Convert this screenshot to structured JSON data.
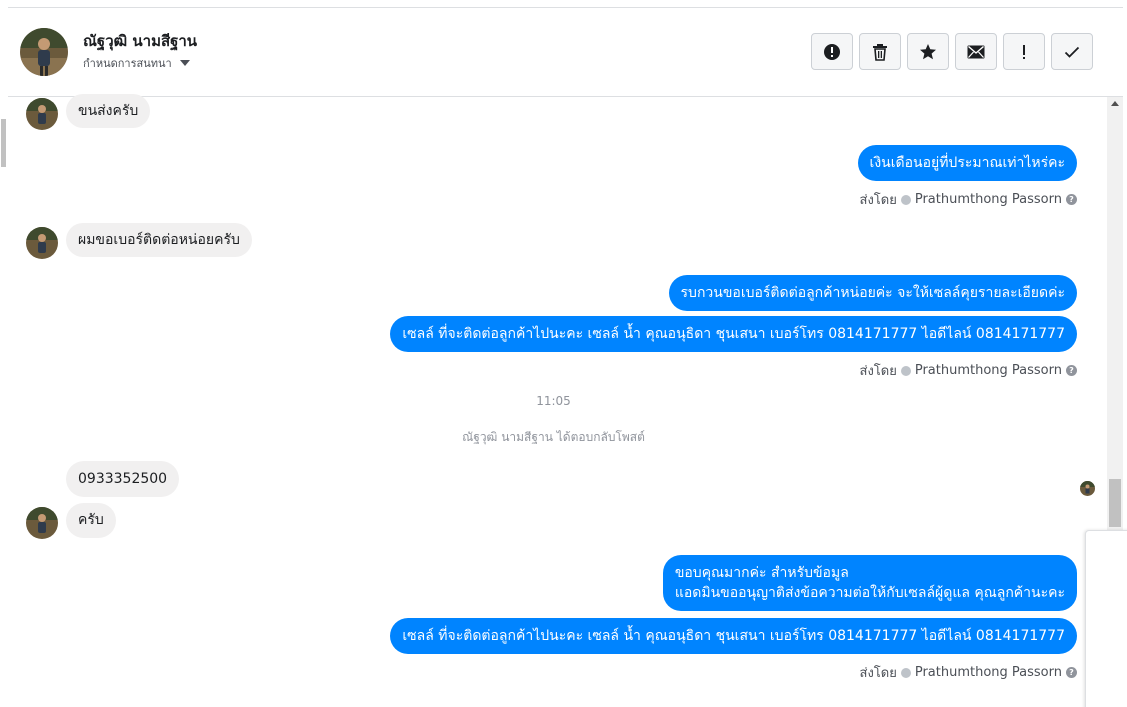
{
  "header": {
    "contact_name": "ณัฐวุฒิ นามสีฐาน",
    "subtitle": "กำหนดการสนทนา",
    "actions": [
      {
        "icon": "alert-circle-icon",
        "label": "mark-spam"
      },
      {
        "icon": "trash-icon",
        "label": "delete"
      },
      {
        "icon": "star-icon",
        "label": "star"
      },
      {
        "icon": "envelope-icon",
        "label": "mark-unread"
      },
      {
        "icon": "exclamation-icon",
        "label": "follow-up"
      },
      {
        "icon": "checkmark-icon",
        "label": "done"
      }
    ]
  },
  "conversation": {
    "messages": [
      {
        "from": "contact",
        "text": "ขนส่งครับ"
      },
      {
        "from": "page",
        "text": "เงินเดือนอยู่ที่ประมาณเท่าไหร่คะ"
      },
      {
        "from": "contact",
        "text": "ผมขอเบอร์ติดต่อหน่อยครับ"
      },
      {
        "from": "page",
        "text": "รบกวนขอเบอร์ติดต่อลูกค้าหน่อยค่ะ จะให้เซลล์คุยรายละเอียดค่ะ"
      },
      {
        "from": "page",
        "text": "เซลล์ ที่จะติดต่อลูกค้าไปนะคะ เซลล์ น้ำ คุณอนุธิดา ชุนเสนา เบอร์โทร 0814171777 ไอดีไลน์ 0814171777"
      },
      {
        "from": "contact",
        "text": "0933352500"
      },
      {
        "from": "contact",
        "text": "ครับ"
      },
      {
        "from": "page",
        "lines": [
          "ขอบคุณมากค่ะ สำหรับข้อมูล",
          "แอดมินขออนุญาติส่งข้อความต่อให้กับเซลล์ผู้ดูแล คุณลูกค้านะคะ"
        ]
      },
      {
        "from": "page",
        "text": "เซลล์ ที่จะติดต่อลูกค้าไปนะคะ เซลล์ น้ำ คุณอนุธิดา ชุนเสนา เบอร์โทร 0814171777 ไอดีไลน์ 0814171777"
      }
    ],
    "sent_by_label": "ส่งโดย",
    "sent_by_name": "Prathumthong Passorn",
    "timestamp": "11:05",
    "system_note": "ณัฐวุฒิ นามสีฐาน ได้ตอบกลับโพสต์"
  },
  "colors": {
    "outgoing_bubble": "#0084ff",
    "incoming_bubble": "#f1f0f0"
  }
}
